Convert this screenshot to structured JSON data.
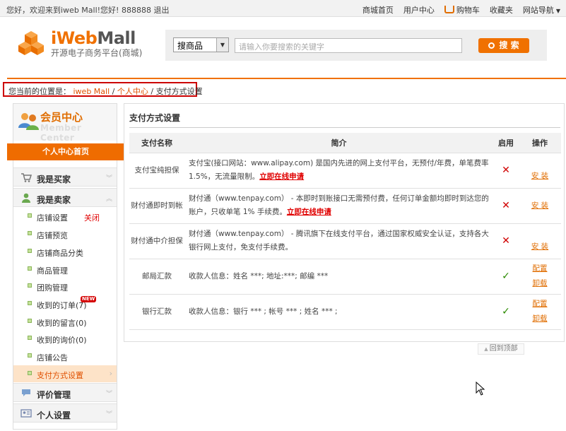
{
  "topbar": {
    "greeting": "您好，欢迎来到iweb Mall!您好! 888888 退出",
    "links": {
      "home": "商城首页",
      "user_center": "用户中心",
      "cart": "购物车",
      "favorites": "收藏夹",
      "site_nav": "网站导航"
    }
  },
  "header": {
    "logo_brand_a": "iWeb",
    "logo_brand_b": "Mall",
    "logo_subtitle": "开源电子商务平台(商城)",
    "search_select": "搜商品",
    "search_placeholder": "请输入你要搜索的关键字",
    "search_button": "搜 索"
  },
  "breadcrumb": {
    "prefix": "您当前的位置是：",
    "items": [
      "iweb Mall",
      "个人中心",
      "支付方式设置"
    ],
    "separator": "/"
  },
  "sidebar": {
    "title": "会员中心",
    "title_en": "Member Center",
    "home_button": "个人中心首页",
    "sections": {
      "buyer": "我是买家",
      "seller": "我是卖家",
      "reviews": "评价管理",
      "personal": "个人设置"
    },
    "seller_items": [
      "店铺设置",
      "店铺预览",
      "店铺商品分类",
      "商品管理",
      "团购管理",
      "收到的订单(7)",
      "收到的留言(0)",
      "收到的询价(0)",
      "店铺公告",
      "支付方式设置"
    ],
    "close_label": "关闭",
    "new_badge": "NEW"
  },
  "panel": {
    "title": "支付方式设置",
    "columns": [
      "支付名称",
      "简介",
      "启用",
      "操作"
    ],
    "rows": [
      {
        "name": "支付宝纯担保",
        "desc": "支付宝(接口网站：www.alipay.com) 是国内先进的网上支付平台，无预付/年费，单笔费率1.5%，无流量限制。",
        "apply": "立即在线申请",
        "enabled": "✕",
        "ops": [
          "安 装"
        ]
      },
      {
        "name": "财付通即时到帐",
        "desc": "财付通（www.tenpay.com） - 本即时到账接口无需预付费，任何订单金额均即时到达您的账户，只收单笔 1% 手续费。",
        "apply": "立即在线申请",
        "enabled": "✕",
        "ops": [
          "安 装"
        ]
      },
      {
        "name": "财付通中介担保",
        "desc": "财付通（www.tenpay.com） - 腾讯旗下在线支付平台，通过国家权威安全认证，支持各大银行网上支付，免支付手续费。",
        "apply": "",
        "enabled": "✕",
        "ops": [
          "安 装"
        ]
      },
      {
        "name": "邮局汇款",
        "desc": "收款人信息：姓名 ***; 地址:***; 邮编 ***",
        "apply": "",
        "enabled": "✓",
        "ops": [
          "配置",
          "卸载"
        ]
      },
      {
        "name": "银行汇款",
        "desc": "收款人信息：银行 *** ; 帐号 *** ; 姓名 *** ;",
        "apply": "",
        "enabled": "✓",
        "ops": [
          "配置",
          "卸载"
        ]
      }
    ]
  },
  "back_to_top": "回到顶部",
  "colors": {
    "accent": "#f07100",
    "danger": "#d00000",
    "success": "#2a8a00"
  }
}
